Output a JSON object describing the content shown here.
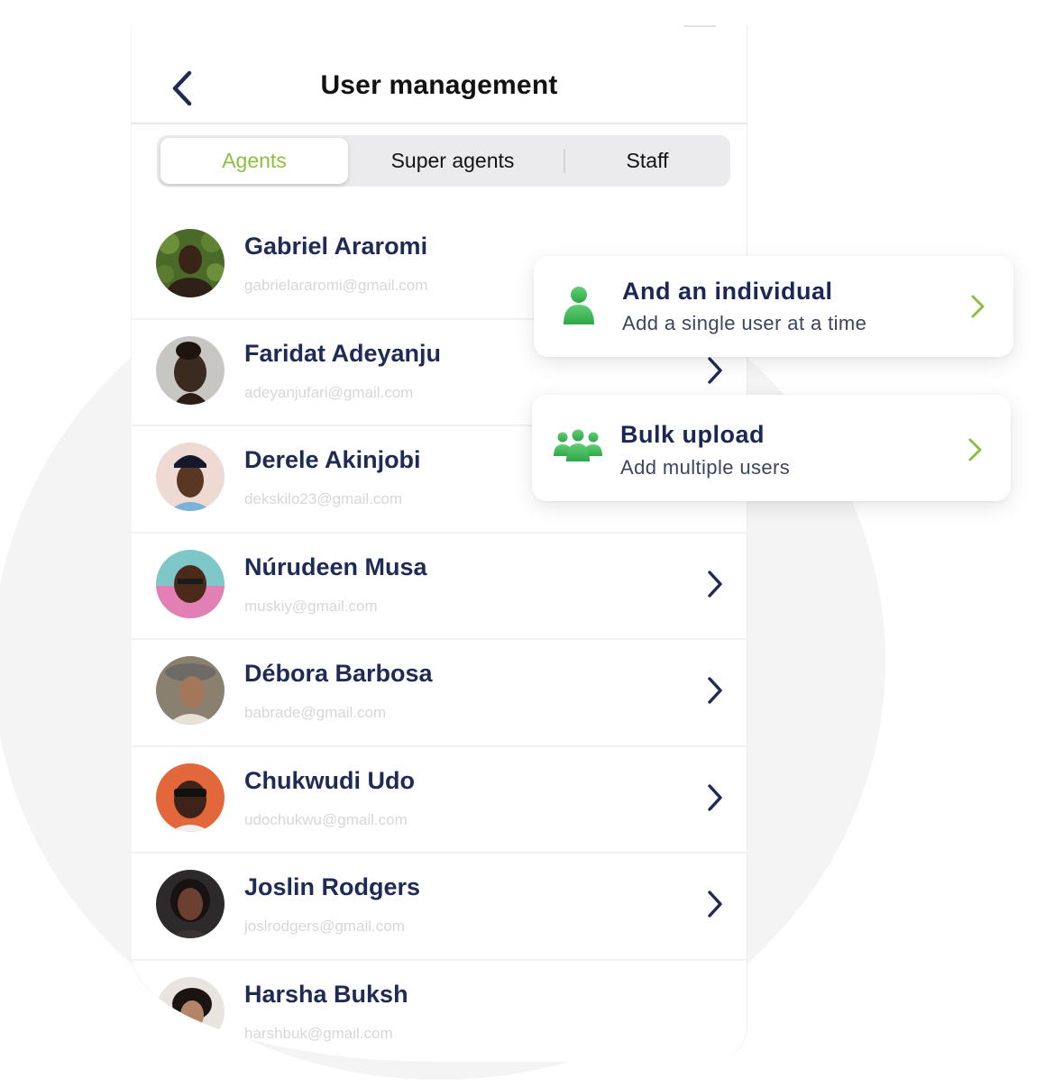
{
  "header": {
    "title": "User management"
  },
  "tabs": [
    {
      "label": "Agents",
      "active": true
    },
    {
      "label": "Super agents",
      "active": false
    },
    {
      "label": "Staff",
      "active": false
    }
  ],
  "users": [
    {
      "name": "Gabriel Araromi",
      "email": "gabrielararomi@gmail.com"
    },
    {
      "name": "Faridat Adeyanju",
      "email": "adeyanjufari@gmail.com"
    },
    {
      "name": "Derele Akinjobi",
      "email": "dekskilo23@gmail.com"
    },
    {
      "name": "Núrudeen Musa",
      "email": "muskiy@gmail.com"
    },
    {
      "name": "Débora Barbosa",
      "email": "babrade@gmail.com"
    },
    {
      "name": "Chukwudi Udo",
      "email": "udochukwu@gmail.com"
    },
    {
      "name": "Joslin Rodgers",
      "email": "joslrodgers@gmail.com"
    },
    {
      "name": "Harsha Buksh",
      "email": "harshbuk@gmail.com"
    }
  ],
  "add_options": [
    {
      "title": "And an individual",
      "subtitle": "Add a single user at a time",
      "icon": "single-user-icon"
    },
    {
      "title": "Bulk upload",
      "subtitle": "Add multiple users",
      "icon": "group-users-icon"
    }
  ],
  "colors": {
    "accent_green": "#8cbf3f",
    "name_navy": "#1f2a55",
    "icon_green": "#3fb85a"
  }
}
